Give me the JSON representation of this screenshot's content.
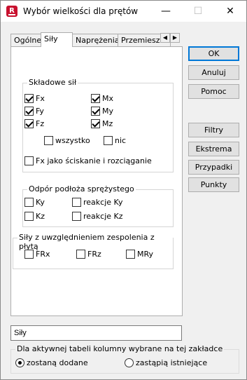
{
  "window": {
    "title": "Wybór wielkości dla prętów",
    "icon": "R"
  },
  "titlebar": {
    "minimize": "—",
    "maximize": "☐",
    "close": "✕"
  },
  "tabs": [
    "Ogólne",
    "Siły",
    "Naprężenia",
    "Przemieszcz"
  ],
  "active_tab": "Siły",
  "tab_scroll": {
    "left": "◀",
    "right": "▶"
  },
  "groups": {
    "skladowe": {
      "label": "Składowe sił",
      "items": [
        {
          "label": "Fx",
          "checked": true
        },
        {
          "label": "Mx",
          "checked": true
        },
        {
          "label": "Fy",
          "checked": true
        },
        {
          "label": "My",
          "checked": true
        },
        {
          "label": "Fz",
          "checked": true
        },
        {
          "label": "Mz",
          "checked": true
        }
      ],
      "all": "wszystko",
      "none": "nic",
      "fx_mode": "Fx jako ściskanie i rozciąganie"
    },
    "odpor": {
      "label": "Odpór podłoża sprężystego",
      "items": [
        {
          "label": "Ky",
          "checked": false
        },
        {
          "label": "reakcje Ky",
          "checked": false
        },
        {
          "label": "Kz",
          "checked": false
        },
        {
          "label": "reakcje Kz",
          "checked": false
        }
      ]
    },
    "zespolenie": {
      "label": "Siły z uwzględnieniem zespolenia z płytą",
      "items": [
        {
          "label": "FRx",
          "checked": false
        },
        {
          "label": "FRz",
          "checked": false
        },
        {
          "label": "MRy",
          "checked": false
        }
      ]
    }
  },
  "buttons": {
    "ok": "OK",
    "cancel": "Anuluj",
    "help": "Pomoc",
    "filters": "Filtry",
    "extrema": "Ekstrema",
    "cases": "Przypadki",
    "points": "Punkty"
  },
  "name_input": {
    "value": "Siły"
  },
  "columns_group": {
    "label": "Dla aktywnej tabeli kolumny wybrane na tej zakładce",
    "options": [
      {
        "label": "zostaną dodane",
        "selected": true
      },
      {
        "label": "zastąpią istniejące",
        "selected": false
      }
    ]
  }
}
